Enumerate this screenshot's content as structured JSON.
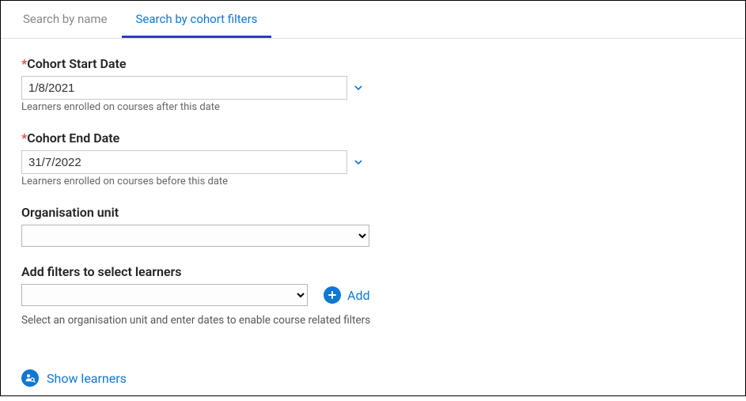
{
  "tabs": {
    "by_name": "Search by name",
    "by_filters": "Search by cohort filters"
  },
  "cohort_start": {
    "label": "Cohort Start Date",
    "required_marker": "*",
    "value": "1/8/2021",
    "helper": "Learners enrolled on courses after this date"
  },
  "cohort_end": {
    "label": "Cohort End Date",
    "required_marker": "*",
    "value": "31/7/2022",
    "helper": "Learners enrolled on courses before this date"
  },
  "org_unit": {
    "label": "Organisation unit",
    "value": ""
  },
  "filters": {
    "label": "Add filters to select learners",
    "value": "",
    "add_label": "Add",
    "note": "Select an organisation unit and enter dates to enable course related filters"
  },
  "show_learners": {
    "label": "Show learners"
  }
}
